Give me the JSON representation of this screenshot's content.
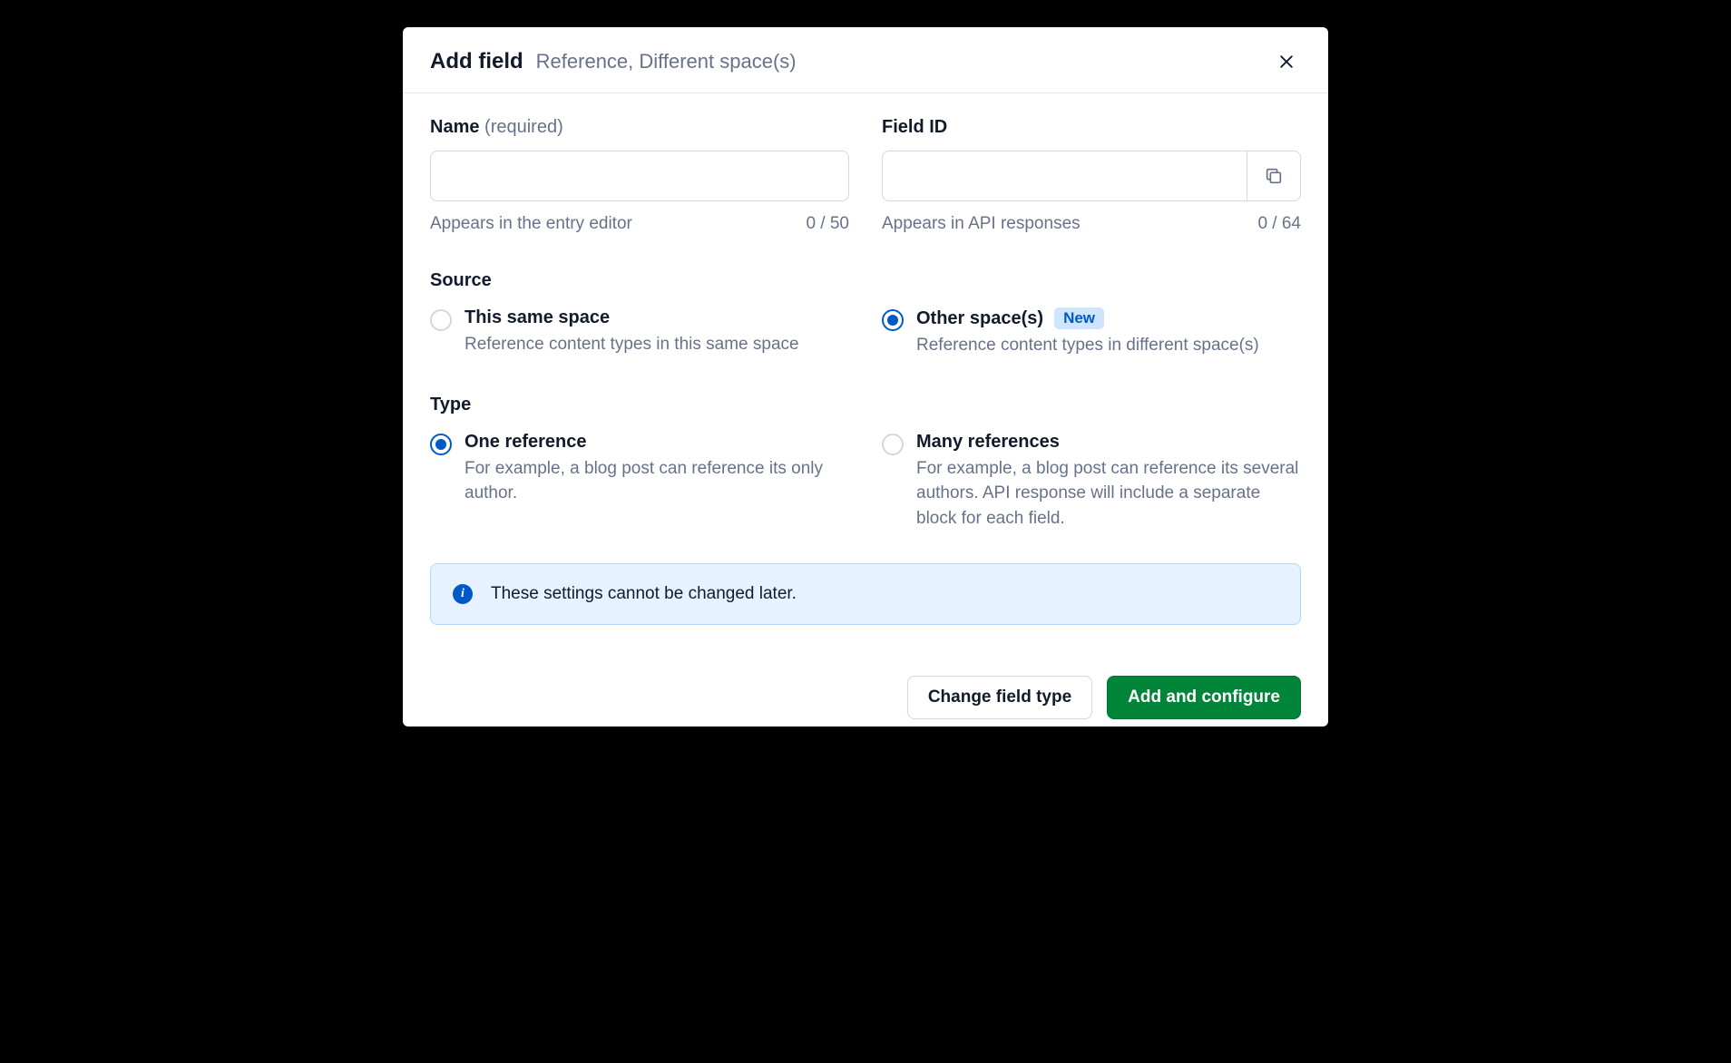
{
  "header": {
    "title": "Add field",
    "subtitle": "Reference, Different space(s)"
  },
  "nameField": {
    "label": "Name",
    "required_suffix": "(required)",
    "value": "",
    "helper": "Appears in the entry editor",
    "counter": "0 / 50"
  },
  "fieldIdField": {
    "label": "Field ID",
    "value": "",
    "helper": "Appears in API responses",
    "counter": "0 / 64"
  },
  "sourceSection": {
    "heading": "Source",
    "options": [
      {
        "title": "This same space",
        "desc": "Reference content types in this same space",
        "selected": false
      },
      {
        "title": "Other space(s)",
        "desc": "Reference content types in different space(s)",
        "selected": true,
        "badge": "New"
      }
    ]
  },
  "typeSection": {
    "heading": "Type",
    "options": [
      {
        "title": "One reference",
        "desc": "For example, a blog post can reference its only author.",
        "selected": true
      },
      {
        "title": "Many references",
        "desc": "For example, a blog post can reference its several authors. API response will include a separate block for each field.",
        "selected": false
      }
    ]
  },
  "infoBanner": {
    "text": "These settings cannot be changed later."
  },
  "footer": {
    "change_label": "Change field type",
    "add_label": "Add and configure"
  }
}
